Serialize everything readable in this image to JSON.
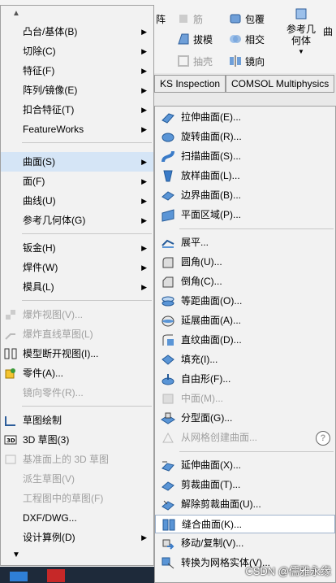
{
  "toolbar": {
    "array_label": "阵",
    "rib_label": "筋",
    "wrap_label": "包覆",
    "draft_label": "拔模",
    "intersect_label": "相交",
    "shell_label": "抽壳",
    "mirror_label": "镜向",
    "ref_geom_label": "参考几何体",
    "curves_label": "曲"
  },
  "tabs": [
    "KS Inspection",
    "COMSOL Multiphysics"
  ],
  "left_menu": {
    "scroll_up_icon": "triangle-up",
    "items": [
      {
        "label": "凸台/基体(B)",
        "arrow": "▶"
      },
      {
        "label": "切除(C)",
        "arrow": "▶"
      },
      {
        "label": "特征(F)",
        "arrow": "▶"
      },
      {
        "label": "阵列/镜像(E)",
        "arrow": "▶"
      },
      {
        "label": "扣合特征(T)",
        "arrow": "▶"
      },
      {
        "label": "FeatureWorks",
        "arrow": "▶"
      },
      {
        "label": "曲面(S)",
        "arrow": "▶"
      },
      {
        "label": "面(F)",
        "arrow": "▶"
      },
      {
        "label": "曲线(U)",
        "arrow": "▶"
      },
      {
        "label": "参考几何体(G)",
        "arrow": "▶"
      },
      {
        "label": "钣金(H)",
        "arrow": "▶"
      },
      {
        "label": "焊件(W)",
        "arrow": "▶"
      },
      {
        "label": "模具(L)",
        "arrow": "▶"
      },
      {
        "label": "爆炸视图(V)..."
      },
      {
        "label": "爆炸直线草图(L)"
      },
      {
        "label": "模型断开视图(I)..."
      },
      {
        "label": "零件(A)..."
      },
      {
        "label": "镜向零件(R)..."
      },
      {
        "label": "草图绘制"
      },
      {
        "label": "3D 草图(3)"
      },
      {
        "label": "基准面上的 3D 草图"
      },
      {
        "label": "派生草图(V)"
      },
      {
        "label": "工程图中的草图(F)"
      },
      {
        "label": "DXF/DWG..."
      },
      {
        "label": "设计算例(D)",
        "arrow": "▶"
      }
    ],
    "scroll_down_icon": "triangle-down"
  },
  "right_menu": {
    "items": [
      {
        "label": "拉伸曲面(E)..."
      },
      {
        "label": "旋转曲面(R)..."
      },
      {
        "label": "扫描曲面(S)..."
      },
      {
        "label": "放样曲面(L)..."
      },
      {
        "label": "边界曲面(B)..."
      },
      {
        "label": "平面区域(P)..."
      },
      {
        "label": "展平..."
      },
      {
        "label": "圆角(U)..."
      },
      {
        "label": "倒角(C)..."
      },
      {
        "label": "等距曲面(O)..."
      },
      {
        "label": "延展曲面(A)..."
      },
      {
        "label": "直纹曲面(D)..."
      },
      {
        "label": "填充(I)..."
      },
      {
        "label": "自由形(F)..."
      },
      {
        "label": "中面(M)..."
      },
      {
        "label": "分型面(G)..."
      },
      {
        "label": "从网格创建曲面..."
      },
      {
        "label": "延伸曲面(X)..."
      },
      {
        "label": "剪裁曲面(T)..."
      },
      {
        "label": "解除剪裁曲面(U)..."
      },
      {
        "label": "缝合曲面(K)..."
      },
      {
        "label": "移动/复制(V)..."
      },
      {
        "label": "转换为网格实体(V)..."
      }
    ],
    "help_glyph": "?"
  },
  "watermark": "CSDN @儒雅永缘",
  "colors": {
    "menu_bg": "#f2f2f2",
    "highlight": "#d5e5f6",
    "disabled": "#a0a0a0",
    "icon_blue": "#3a7bc8"
  }
}
